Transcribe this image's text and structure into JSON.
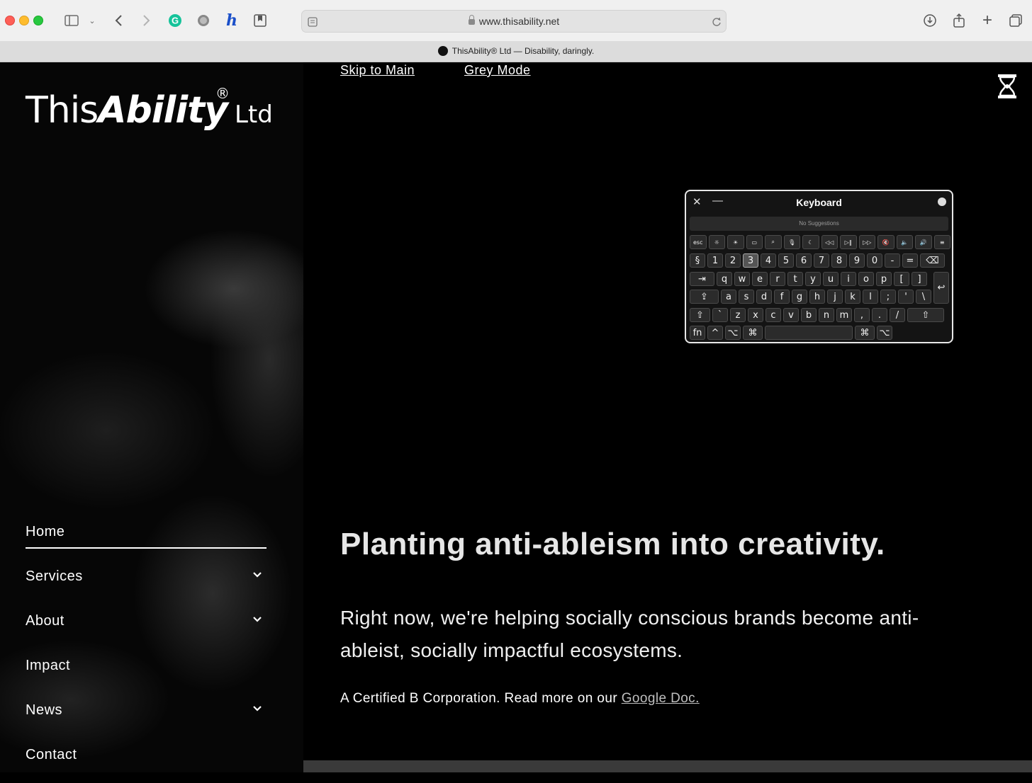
{
  "browser": {
    "url": "www.thisability.net",
    "tab_title": "ThisAbility® Ltd — Disability, daringly."
  },
  "site": {
    "logo": {
      "this": "This",
      "ability": "Ability",
      "reg": "®",
      "ltd": "Ltd"
    },
    "skip_links": [
      "Skip to Main",
      "Grey Mode"
    ],
    "nav": [
      {
        "label": "Home",
        "active": true,
        "has_submenu": false
      },
      {
        "label": "Services",
        "active": false,
        "has_submenu": true
      },
      {
        "label": "About",
        "active": false,
        "has_submenu": true
      },
      {
        "label": "Impact",
        "active": false,
        "has_submenu": false
      },
      {
        "label": "News",
        "active": false,
        "has_submenu": true
      },
      {
        "label": "Contact",
        "active": false,
        "has_submenu": false
      }
    ],
    "headline": "Planting anti-ableism into creativity.",
    "lead": "Right now, we're helping socially conscious brands become anti-ableist, socially impactful ecosystems.",
    "bcorp_text": "A Certified B Corporation. Read more on our",
    "bcorp_link": "Google Doc."
  },
  "keyboard": {
    "title": "Keyboard",
    "suggestions": "No Suggestions",
    "fn_row": [
      "esc",
      "☼",
      "☀",
      "▭",
      "⌕",
      "🎙",
      "☾",
      "◁◁",
      "▷‖",
      "▷▷",
      "🔇",
      "🔈",
      "🔊",
      "≡"
    ],
    "num_row": [
      "§",
      "1",
      "2",
      "3",
      "4",
      "5",
      "6",
      "7",
      "8",
      "9",
      "0",
      "-",
      "=",
      "⌫"
    ],
    "q_row": [
      "⇥",
      "q",
      "w",
      "e",
      "r",
      "t",
      "y",
      "u",
      "i",
      "o",
      "p",
      "[",
      "]"
    ],
    "a_row": [
      "⇪",
      "a",
      "s",
      "d",
      "f",
      "g",
      "h",
      "j",
      "k",
      "l",
      ";",
      "'",
      "\\"
    ],
    "z_row": [
      "⇧",
      "`",
      "z",
      "x",
      "c",
      "v",
      "b",
      "n",
      "m",
      ",",
      ".",
      "/",
      "⇧"
    ],
    "bottom_row": [
      "fn",
      "^",
      "⌥",
      "⌘",
      "",
      "⌘",
      "⌥"
    ],
    "return_key": "↩",
    "highlighted_key": "3"
  }
}
